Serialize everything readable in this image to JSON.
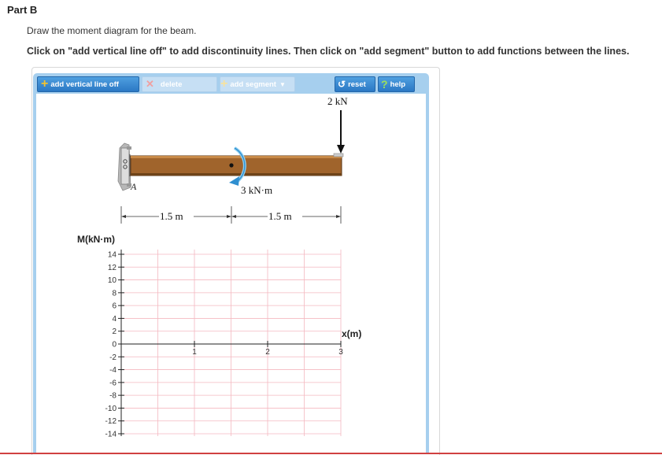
{
  "part": {
    "title": "Part B"
  },
  "instructions": {
    "line1": "Draw the moment diagram for the beam.",
    "line2": "Click on \"add vertical line off\" to add discontinuity lines. Then click on \"add segment\" button to add functions between the lines."
  },
  "toolbar": {
    "add_vertical_line": "add vertical line off",
    "delete": "delete",
    "add_segment": "add segment",
    "reset": "reset",
    "help": "help"
  },
  "beam": {
    "load_label": "2 kN",
    "moment_label": "3 kN·m",
    "support_label": "A",
    "dim1": "1.5 m",
    "dim2": "1.5 m"
  },
  "graph": {
    "y_label": "M(kN·m)",
    "x_label": "x(m)",
    "y_ticks": [
      "14",
      "12",
      "10",
      "8",
      "6",
      "4",
      "2",
      "0",
      "-2",
      "-4",
      "-6",
      "-8",
      "-10",
      "-12",
      "-14"
    ],
    "x_ticks": [
      "1",
      "2",
      "3"
    ]
  },
  "colors": {
    "accent": "#2b78c4",
    "grid": "#f4b8c0",
    "beam": "#a0642c"
  }
}
